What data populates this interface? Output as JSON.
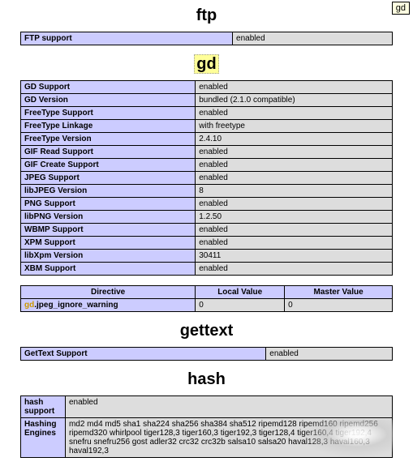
{
  "tooltip": "gd",
  "sections": {
    "ftp": {
      "title": "ftp",
      "rows": [
        {
          "key": "FTP support",
          "val": "enabled"
        }
      ]
    },
    "gd": {
      "title": "gd",
      "rows": [
        {
          "key": "GD Support",
          "val": "enabled"
        },
        {
          "key": "GD Version",
          "val": "bundled (2.1.0 compatible)"
        },
        {
          "key": "FreeType Support",
          "val": "enabled"
        },
        {
          "key": "FreeType Linkage",
          "val": "with freetype"
        },
        {
          "key": "FreeType Version",
          "val": "2.4.10"
        },
        {
          "key": "GIF Read Support",
          "val": "enabled"
        },
        {
          "key": "GIF Create Support",
          "val": "enabled"
        },
        {
          "key": "JPEG Support",
          "val": "enabled"
        },
        {
          "key": "libJPEG Version",
          "val": "8"
        },
        {
          "key": "PNG Support",
          "val": "enabled"
        },
        {
          "key": "libPNG Version",
          "val": "1.2.50"
        },
        {
          "key": "WBMP Support",
          "val": "enabled"
        },
        {
          "key": "XPM Support",
          "val": "enabled"
        },
        {
          "key": "libXpm Version",
          "val": "30411"
        },
        {
          "key": "XBM Support",
          "val": "enabled"
        }
      ],
      "directives": {
        "headers": [
          "Directive",
          "Local Value",
          "Master Value"
        ],
        "rows": [
          {
            "name_prefix": "gd",
            "name_rest": ".jpeg_ignore_warning",
            "local": "0",
            "master": "0"
          }
        ]
      }
    },
    "gettext": {
      "title": "gettext",
      "rows": [
        {
          "key": "GetText Support",
          "val": "enabled"
        }
      ]
    },
    "hash": {
      "title": "hash",
      "rows": [
        {
          "key": "hash support",
          "val": "enabled"
        },
        {
          "key": "Hashing Engines",
          "val": "md2 md4 md5 sha1 sha224 sha256 sha384 sha512 ripemd128 ripemd160 ripemd256 ripemd320 whirlpool tiger128,3 tiger160,3 tiger192,3 tiger128,4 tiger160,4 tiger192,4 snefru snefru256 gost adler32 crc32 crc32b salsa10 salsa20 haval128,3 haval160,3 haval192,3"
        }
      ]
    }
  }
}
